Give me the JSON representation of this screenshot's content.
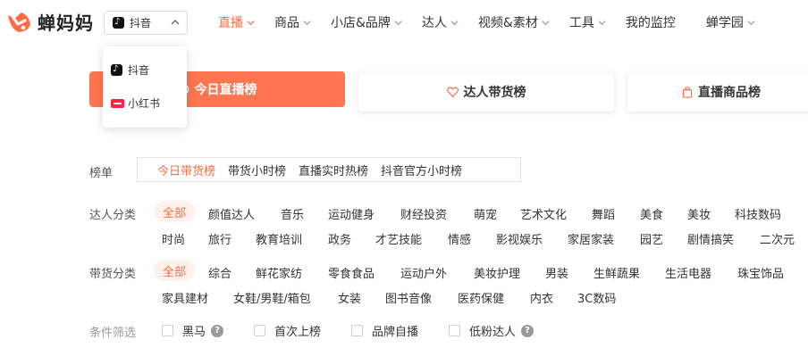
{
  "brand": {
    "name": "蝉妈妈",
    "color": "#ff6c43"
  },
  "platform": {
    "selected": "抖音",
    "icon": "tiktok-icon"
  },
  "nav": [
    {
      "label": "直播",
      "active": true,
      "dropdown": true
    },
    {
      "label": "商品",
      "dropdown": true
    },
    {
      "label": "小店&品牌",
      "dropdown": true
    },
    {
      "label": "达人",
      "dropdown": true
    },
    {
      "label": "视频&素材",
      "dropdown": true
    },
    {
      "label": "工具",
      "dropdown": true
    },
    {
      "label": "我的监控",
      "dropdown": false
    },
    {
      "label": "蝉学园",
      "dropdown": true
    }
  ],
  "dropdown": {
    "items": [
      {
        "label": "抖音",
        "icon": "tiktok-icon"
      },
      {
        "label": "小红书",
        "icon": "xiaohongshu-icon"
      }
    ]
  },
  "rank_tabs": [
    {
      "label": "今日直播榜",
      "active": true
    },
    {
      "label": "达人带货榜",
      "active": false
    },
    {
      "label": "直播商品榜",
      "active": false
    }
  ],
  "filters": {
    "board_label": "榜单",
    "boards": [
      "今日带货榜",
      "带货小时榜",
      "直播实时热榜",
      "抖音官方小时榜"
    ],
    "creator_label": "达人分类",
    "creator_row1": [
      "全部",
      "颜值达人",
      "音乐",
      "运动健身",
      "财经投资",
      "萌宠",
      "艺术文化",
      "舞蹈",
      "美食",
      "美妆",
      "科技数码"
    ],
    "creator_row2": [
      "时尚",
      "旅行",
      "教育培训",
      "政务",
      "才艺技能",
      "情感",
      "影视娱乐",
      "家居家装",
      "园艺",
      "剧情搞笑",
      "二次元"
    ],
    "goods_label": "带货分类",
    "goods_row1": [
      "全部",
      "综合",
      "鲜花家纺",
      "零食食品",
      "运动户外",
      "美妆护理",
      "男装",
      "生鲜蔬果",
      "生活电器",
      "珠宝饰品"
    ],
    "goods_row2": [
      "家具建材",
      "女鞋/男鞋/箱包",
      "女装",
      "图书音像",
      "医药保健",
      "内衣",
      "3C数码"
    ],
    "cond_label": "条件筛选",
    "conditions": [
      {
        "label": "黑马",
        "help": "?"
      },
      {
        "label": "首次上榜"
      },
      {
        "label": "品牌自播"
      },
      {
        "label": "低粉达人",
        "help": "?"
      }
    ]
  }
}
